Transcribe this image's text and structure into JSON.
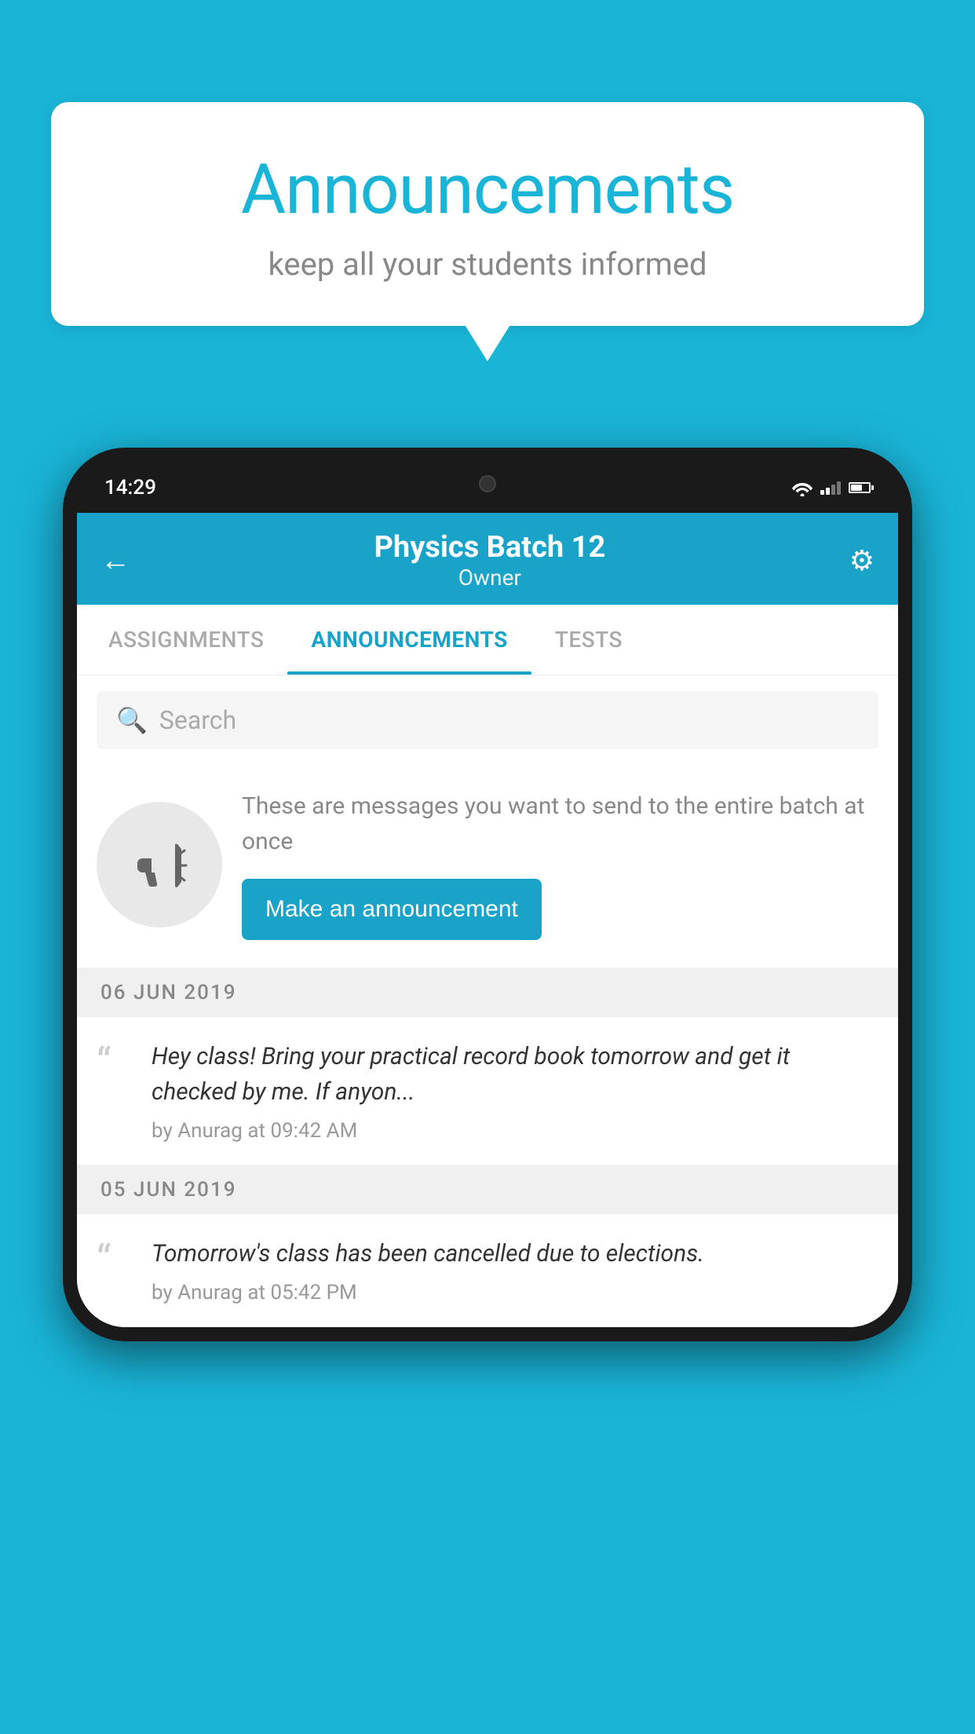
{
  "background_color": "#1ab4d7",
  "speech_bubble": {
    "title": "Announcements",
    "subtitle": "keep all your students informed"
  },
  "phone": {
    "status_bar": {
      "time": "14:29"
    },
    "header": {
      "title": "Physics Batch 12",
      "subtitle": "Owner",
      "back_label": "←",
      "settings_label": "⚙"
    },
    "tabs": [
      {
        "label": "ASSIGNMENTS",
        "active": false
      },
      {
        "label": "ANNOUNCEMENTS",
        "active": true
      },
      {
        "label": "TESTS",
        "active": false
      },
      {
        "label": "...",
        "active": false
      }
    ],
    "search": {
      "placeholder": "Search"
    },
    "announcement_prompt": {
      "description": "These are messages you want to send to the entire batch at once",
      "button_label": "Make an announcement"
    },
    "date_groups": [
      {
        "date": "06  JUN  2019",
        "items": [
          {
            "text": "Hey class! Bring your practical record book tomorrow and get it checked by me. If anyon...",
            "meta": "by Anurag at 09:42 AM"
          }
        ]
      },
      {
        "date": "05  JUN  2019",
        "items": [
          {
            "text": "Tomorrow's class has been cancelled due to elections.",
            "meta": "by Anurag at 05:42 PM"
          }
        ]
      }
    ]
  }
}
